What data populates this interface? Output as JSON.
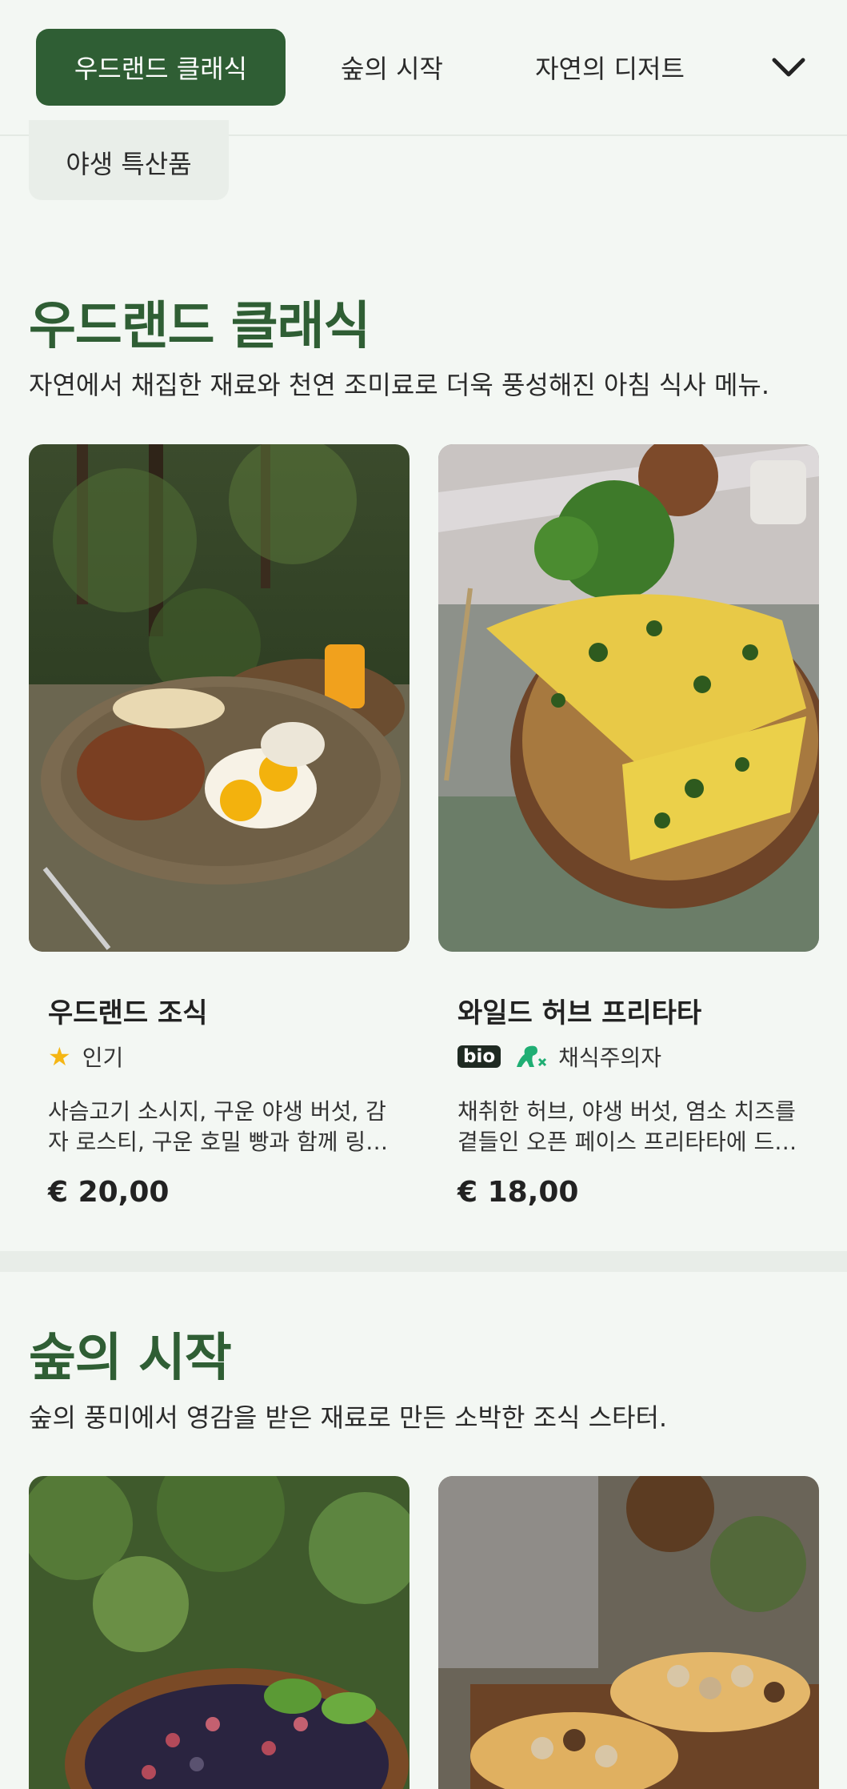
{
  "tabs": [
    "우드랜드 클래식",
    "숲의 시작",
    "자연의 디저트"
  ],
  "chip": "야생 특산품",
  "icons": {
    "more": "chevron-down-icon",
    "popular": "star-icon",
    "vegetarian": "dinosaur-leaf-icon"
  },
  "colors": {
    "accent": "#2f5e34",
    "star": "#f5b614",
    "veg": "#1fae73"
  },
  "sections": [
    {
      "title": "우드랜드 클래식",
      "description": "자연에서 채집한 재료와 천연 조미료로 더욱 풍성해진 아침 식사 메뉴.",
      "items": [
        {
          "name": "우드랜드 조식",
          "tag": "인기",
          "description": "사슴고기 소시지, 구운 야생 버섯, 감자 로스티, 구운 호밀 빵과 함께 링…",
          "price": "€ 20,00"
        },
        {
          "name": "와일드 허브 프리타타",
          "badge": "bio",
          "tag": "채식주의자",
          "description": "채취한 허브, 야생 버섯, 염소 치즈를 곁들인 오픈 페이스 프리타타에 드…",
          "price": "€ 18,00"
        }
      ]
    },
    {
      "title": "숲의 시작",
      "description": "숲의 풍미에서 영감을 받은 재료로 만든 소박한 조식 스타터."
    }
  ]
}
